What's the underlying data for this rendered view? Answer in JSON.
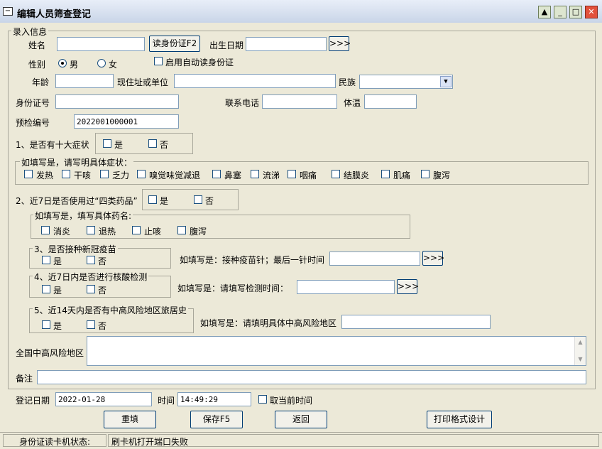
{
  "window": {
    "title": "编辑人员筛查登记"
  },
  "form": {
    "group_title": "录入信息",
    "name_label": "姓名",
    "read_id_button": "读身份证F2",
    "birth_label": "出生日期",
    "more_button": ">>>",
    "gender_label": "性别",
    "gender_male": "男",
    "gender_female": "女",
    "auto_read_label": "启用自动读身份证",
    "age_label": "年龄",
    "address_label": "现住址或单位",
    "ethnicity_label": "民族",
    "id_label": "身份证号",
    "phone_label": "联系电话",
    "temp_label": "体温",
    "precheck_label": "预检编号",
    "precheck_value": "2022001000001",
    "q1_label": "1、是否有十大症状",
    "yes": "是",
    "no": "否",
    "symptom_group": "如填写是，请写明具体症状：",
    "symptoms": [
      "发热",
      "干咳",
      "乏力",
      "嗅觉味觉减退",
      "鼻塞",
      "流涕",
      "咽痛",
      "结膜炎",
      "肌痛",
      "腹泻"
    ],
    "q2_label": "2、近7日是否使用过“四类药品”",
    "drug_group": "如填写是，填写具体药名:",
    "drugs": [
      "消炎",
      "退热",
      "止咳",
      "腹泻"
    ],
    "q3_label": "3、是否接种新冠疫苗",
    "q3_detail": "如填写是：接种疫苗针；最后一针时间",
    "q4_label": "4、近7日内是否进行核酸检测",
    "q4_detail": "如填写是：请填写检测时间：",
    "q5_label": "5、近14天内是否有中高风险地区旅居史",
    "q5_detail": "如填写是：请填明具体中高风险地区",
    "risk_area_label": "全国中高风险地区",
    "remark_label": "备注",
    "reg_date_label": "登记日期",
    "reg_date_value": "2022-01-28",
    "time_label": "时间",
    "time_value": "14:49:29",
    "current_time_label": "取当前时间"
  },
  "buttons": {
    "reset": "重填",
    "save": "保存F5",
    "back": "返回",
    "print_design": "打印格式设计"
  },
  "status": {
    "reader_label": "身份证读卡机状态:",
    "reader_value": "刷卡机打开端口失败"
  }
}
